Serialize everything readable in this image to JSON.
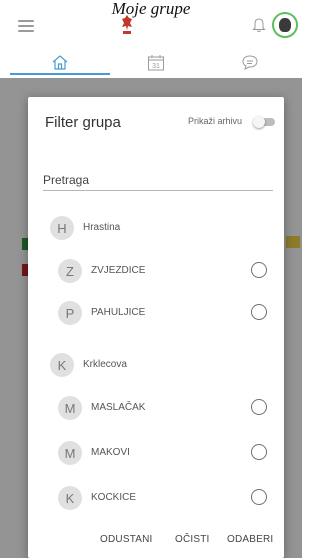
{
  "header": {
    "title": "Moje grupe"
  },
  "tabs": [
    {
      "label": "home-icon",
      "active": true
    },
    {
      "label": "calendar-icon",
      "day": "31"
    },
    {
      "label": "chat-icon"
    }
  ],
  "dialog": {
    "title": "Filter grupa",
    "archive_label": "Prikaži arhivu",
    "search_placeholder": "Pretraga",
    "groups": [
      {
        "initial": "H",
        "name": "Hrastina",
        "children": [
          {
            "initial": "Z",
            "name": "ZVJEZDICE"
          },
          {
            "initial": "P",
            "name": "PAHULJICE"
          }
        ]
      },
      {
        "initial": "K",
        "name": "Krklecova",
        "children": [
          {
            "initial": "M",
            "name": "MASLAČAK"
          },
          {
            "initial": "M",
            "name": "MAKOVI"
          },
          {
            "initial": "K",
            "name": "KOCKICE"
          }
        ]
      }
    ],
    "actions": {
      "cancel": "ODUSTANI",
      "clear": "OČISTI",
      "select": "ODABERI"
    }
  },
  "colors": {
    "accent": "#4a9bd4",
    "avatar_ring": "#5cc05c"
  }
}
